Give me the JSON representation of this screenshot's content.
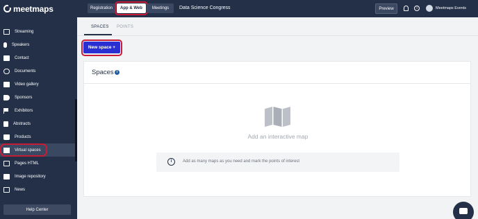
{
  "brand": {
    "logo_text": "meetmaps"
  },
  "topbar": {
    "nav": [
      "Registration",
      "App & Web",
      "Meetings"
    ],
    "event_name": "Data Science Congress",
    "preview_label": "Preview",
    "account_name": "Meetmaps Events"
  },
  "sidebar": {
    "items": [
      {
        "label": "Streaming",
        "icon": "tv-icon"
      },
      {
        "label": "Speakers",
        "icon": "microphone-icon"
      },
      {
        "label": "Contact",
        "icon": "chat-icon"
      },
      {
        "label": "Documents",
        "icon": "paperclip-icon"
      },
      {
        "label": "Video gallery",
        "icon": "video-icon"
      },
      {
        "label": "Sponsors",
        "icon": "megaphone-icon"
      },
      {
        "label": "Exhibitors",
        "icon": "flag-icon"
      },
      {
        "label": "Abstracts",
        "icon": "document-icon"
      },
      {
        "label": "Products",
        "icon": "bag-icon"
      },
      {
        "label": "Virtual spaces",
        "icon": "map-icon"
      },
      {
        "label": "Pages HTML",
        "icon": "page-icon"
      },
      {
        "label": "Image repository",
        "icon": "image-icon"
      },
      {
        "label": "News",
        "icon": "newspaper-icon"
      }
    ],
    "help_label": "Help Center"
  },
  "main": {
    "tabs": [
      "SPACES",
      "POINTS"
    ],
    "new_space_label": "New space  +",
    "panel_title": "Spaces",
    "empty_title": "Add an interactive map",
    "hint_text": "Add as many maps as you need and mark the points of interest"
  },
  "colors": {
    "nav_bg": "#233047",
    "primary_button": "#2a2fd1",
    "highlight": "#c81c36"
  }
}
